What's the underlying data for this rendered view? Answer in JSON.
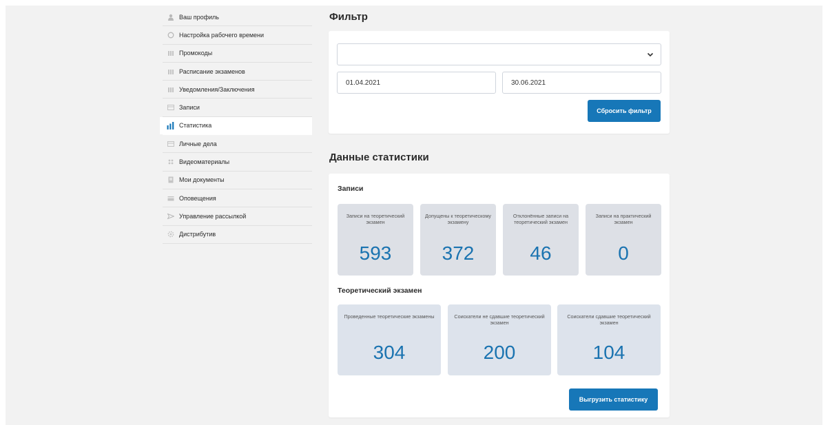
{
  "sidebar": {
    "items": [
      {
        "label": "Ваш профиль",
        "icon": "user-icon",
        "active": false
      },
      {
        "label": "Настройка рабочего времени",
        "icon": "clock-icon",
        "active": false
      },
      {
        "label": "Промокоды",
        "icon": "tag-icon",
        "active": false
      },
      {
        "label": "Расписание экзаменов",
        "icon": "calendar-icon",
        "active": false
      },
      {
        "label": "Уведомления/Заключения",
        "icon": "book-icon",
        "active": false
      },
      {
        "label": "Записи",
        "icon": "list-icon",
        "active": false
      },
      {
        "label": "Статистика",
        "icon": "bar-chart-icon",
        "active": true
      },
      {
        "label": "Личные дела",
        "icon": "folder-icon",
        "active": false
      },
      {
        "label": "Видеоматериалы",
        "icon": "video-icon",
        "active": false
      },
      {
        "label": "Мои документы",
        "icon": "document-icon",
        "active": false
      },
      {
        "label": "Оповещения",
        "icon": "mail-icon",
        "active": false
      },
      {
        "label": "Управление рассылкой",
        "icon": "send-icon",
        "active": false
      },
      {
        "label": "Дистрибутив",
        "icon": "gear-icon",
        "active": false
      }
    ]
  },
  "filter": {
    "heading": "Фильтр",
    "select_value": "",
    "date_from": "01.04.2021",
    "date_to": "30.06.2021",
    "reset_label": "Сбросить фильтр"
  },
  "stats": {
    "heading": "Данные статистики",
    "records_title": "Записи",
    "records": [
      {
        "label": "Записи на теоретический экзамен",
        "value": "593"
      },
      {
        "label": "Допущены к теоретическому экзамену",
        "value": "372"
      },
      {
        "label": "Отклонённые записи на теоретический экзамен",
        "value": "46"
      },
      {
        "label": "Записи на практический экзамен",
        "value": "0"
      }
    ],
    "theory_title": "Теоретический экзамен",
    "theory": [
      {
        "label": "Проведенные теоретические экзамены",
        "value": "304"
      },
      {
        "label": "Соискатели не сдавшие теоретический экзамен",
        "value": "200"
      },
      {
        "label": "Соискатели сдавшие теоретический экзамен",
        "value": "104"
      }
    ],
    "export_label": "Выгрузить статистику"
  },
  "colors": {
    "accent": "#1777b8",
    "value_text": "#1a73b0",
    "tile_bg": "#dde0e6",
    "page_bg": "#f2f2f2"
  }
}
